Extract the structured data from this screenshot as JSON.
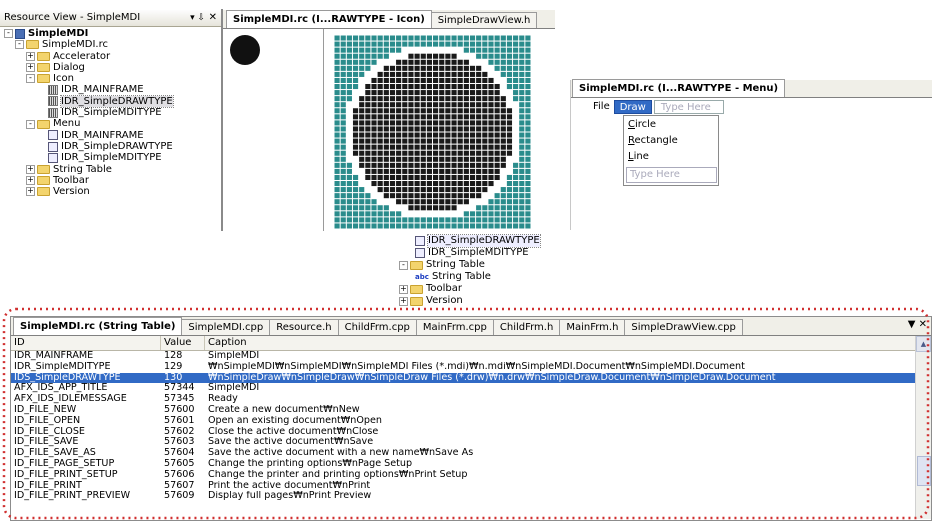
{
  "resource_view": {
    "title": "Resource View - SimpleMDI",
    "pin": "▾ ⇩",
    "close": "✕",
    "items": [
      {
        "label": "SimpleMDI",
        "level": 0,
        "exp": "-",
        "icon": "root",
        "bold": true
      },
      {
        "label": "SimpleMDI.rc",
        "level": 1,
        "exp": "-",
        "icon": "folder"
      },
      {
        "label": "Accelerator",
        "level": 2,
        "exp": "+",
        "icon": "folder"
      },
      {
        "label": "Dialog",
        "level": 2,
        "exp": "+",
        "icon": "folder"
      },
      {
        "label": "Icon",
        "level": 2,
        "exp": "-",
        "icon": "folder"
      },
      {
        "label": "IDR_MAINFRAME",
        "level": 3,
        "exp": "",
        "icon": "icon"
      },
      {
        "label": "IDR_SimpleDRAWTYPE",
        "level": 3,
        "exp": "",
        "icon": "icon",
        "selected": true
      },
      {
        "label": "IDR_SimpleMDITYPE",
        "level": 3,
        "exp": "",
        "icon": "icon"
      },
      {
        "label": "Menu",
        "level": 2,
        "exp": "-",
        "icon": "folder"
      },
      {
        "label": "IDR_MAINFRAME",
        "level": 3,
        "exp": "",
        "icon": "menu"
      },
      {
        "label": "IDR_SimpleDRAWTYPE",
        "level": 3,
        "exp": "",
        "icon": "menu"
      },
      {
        "label": "IDR_SimpleMDITYPE",
        "level": 3,
        "exp": "",
        "icon": "menu"
      },
      {
        "label": "String Table",
        "level": 2,
        "exp": "+",
        "icon": "folder"
      },
      {
        "label": "Toolbar",
        "level": 2,
        "exp": "+",
        "icon": "folder"
      },
      {
        "label": "Version",
        "level": 2,
        "exp": "+",
        "icon": "folder"
      }
    ]
  },
  "icon_editor": {
    "tabs": [
      {
        "label": "SimpleMDI.rc (I...RAWTYPE - Icon)",
        "active": true
      },
      {
        "label": "SimpleDrawView.h",
        "active": false
      }
    ],
    "colors": {
      "bg": "#2a8c8c",
      "ink": "#1a1a1a",
      "grid": "#ffffff"
    }
  },
  "menu_editor": {
    "title": "SimpleMDI.rc (I...RAWTYPE - Menu)",
    "bar": [
      "File",
      "Draw",
      "Type Here"
    ],
    "items": [
      "Circle",
      "Rectangle",
      "Line"
    ],
    "mnemonics": [
      "C",
      "R",
      "L"
    ],
    "rests": [
      "ircle",
      "ectangle",
      "ine"
    ],
    "type_here": "Type Here"
  },
  "tree_fragment": {
    "items": [
      {
        "label": "IDR_SimpleDRAWTYPE",
        "icon": "menu",
        "exp": "",
        "indent": 2,
        "selected": true
      },
      {
        "label": "IDR_SimpleMDITYPE",
        "icon": "menu",
        "exp": "",
        "indent": 2
      },
      {
        "label": "String Table",
        "icon": "folder",
        "exp": "-",
        "indent": 1
      },
      {
        "label": "String Table",
        "icon": "abc",
        "exp": "",
        "indent": 2
      },
      {
        "label": "Toolbar",
        "icon": "folder",
        "exp": "+",
        "indent": 1
      },
      {
        "label": "Version",
        "icon": "folder",
        "exp": "+",
        "indent": 1
      }
    ]
  },
  "string_table": {
    "tabs": [
      {
        "label": "SimpleMDI.rc (String Table)",
        "active": true
      },
      {
        "label": "SimpleMDI.cpp"
      },
      {
        "label": "Resource.h"
      },
      {
        "label": "ChildFrm.cpp"
      },
      {
        "label": "MainFrm.cpp"
      },
      {
        "label": "ChildFrm.h"
      },
      {
        "label": "MainFrm.h"
      },
      {
        "label": "SimpleDrawView.cpp"
      }
    ],
    "tab_controls": "▼ ✕",
    "columns": [
      "ID",
      "Value",
      "Caption"
    ],
    "rows": [
      {
        "id": "IDR_MAINFRAME",
        "value": "128",
        "caption": "SimpleMDI"
      },
      {
        "id": "IDR_SimpleMDITYPE",
        "value": "129",
        "caption": "₩nSimpleMDI₩nSimpleMDI₩nSimpleMDI Files (*.mdi)₩n.mdi₩nSimpleMDI.Document₩nSimpleMDI.Document"
      },
      {
        "id": "IDS_SimpleDRAWTYPE",
        "value": "130",
        "caption": "₩nSimpleDraw₩nSimpleDraw₩nSimpleDraw Files (*.drw)₩n.drw₩nSimpleDraw.Document₩nSimpleDraw.Document",
        "selected": true
      },
      {
        "id": "AFX_IDS_APP_TITLE",
        "value": "57344",
        "caption": "SimpleMDI"
      },
      {
        "id": "AFX_IDS_IDLEMESSAGE",
        "value": "57345",
        "caption": "Ready"
      },
      {
        "id": "ID_FILE_NEW",
        "value": "57600",
        "caption": "Create a new document₩nNew"
      },
      {
        "id": "ID_FILE_OPEN",
        "value": "57601",
        "caption": "Open an existing document₩nOpen"
      },
      {
        "id": "ID_FILE_CLOSE",
        "value": "57602",
        "caption": "Close the active document₩nClose"
      },
      {
        "id": "ID_FILE_SAVE",
        "value": "57603",
        "caption": "Save the active document₩nSave"
      },
      {
        "id": "ID_FILE_SAVE_AS",
        "value": "57604",
        "caption": "Save the active document with a new name₩nSave As"
      },
      {
        "id": "ID_FILE_PAGE_SETUP",
        "value": "57605",
        "caption": "Change the printing options₩nPage Setup"
      },
      {
        "id": "ID_FILE_PRINT_SETUP",
        "value": "57606",
        "caption": "Change the printer and printing options₩nPrint Setup"
      },
      {
        "id": "ID_FILE_PRINT",
        "value": "57607",
        "caption": "Print the active document₩nPrint"
      },
      {
        "id": "ID_FILE_PRINT_PREVIEW",
        "value": "57609",
        "caption": "Display full pages₩nPrint Preview"
      }
    ],
    "highlight_color": "#d03030",
    "select_color": "#316ac5"
  }
}
